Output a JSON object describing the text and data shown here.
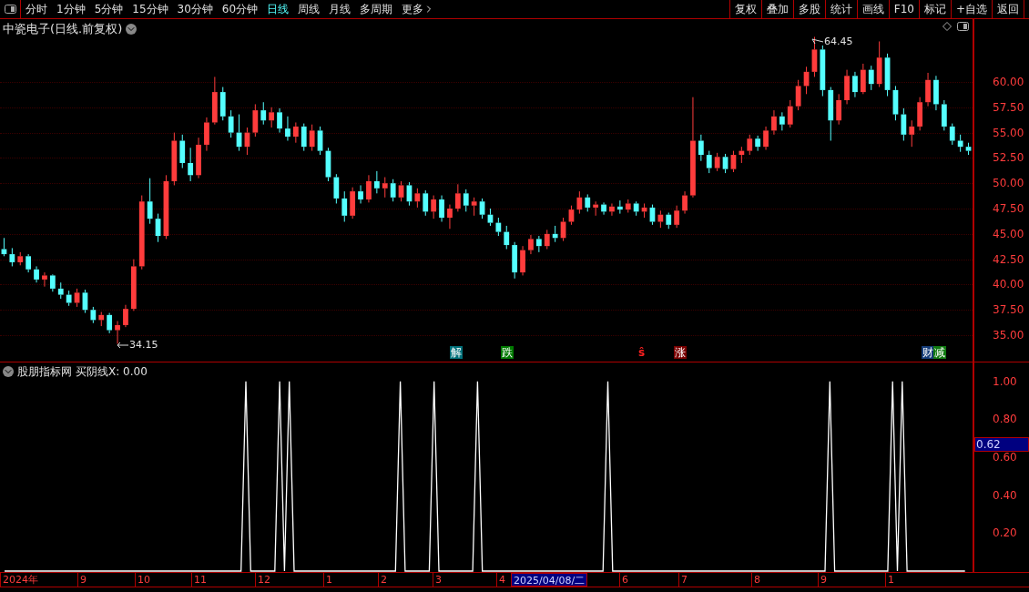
{
  "toolbar": {
    "periods": [
      {
        "label": "分时",
        "selected": false
      },
      {
        "label": "1分钟",
        "selected": false
      },
      {
        "label": "5分钟",
        "selected": false
      },
      {
        "label": "15分钟",
        "selected": false
      },
      {
        "label": "30分钟",
        "selected": false
      },
      {
        "label": "60分钟",
        "selected": false
      },
      {
        "label": "日线",
        "selected": true
      },
      {
        "label": "周线",
        "selected": false
      },
      {
        "label": "月线",
        "selected": false
      },
      {
        "label": "多周期",
        "selected": false
      }
    ],
    "more": "更多",
    "buttons": [
      "复权",
      "叠加",
      "多股",
      "统计",
      "画线",
      "F10",
      "标记",
      "+自选",
      "返回"
    ]
  },
  "price_pane": {
    "title": "中瓷电子(日线.前复权)",
    "high_label": "64.45",
    "low_label": "34.15",
    "signals": [
      {
        "text": "解",
        "kind": "boxed",
        "color": "#00707a"
      },
      {
        "text": "跌",
        "kind": "boxed",
        "color": "#007a00"
      },
      {
        "text": "ŝ",
        "kind": "plain",
        "color": "#ff2020"
      },
      {
        "text": "涨",
        "kind": "boxed",
        "color": "#7a0000"
      },
      {
        "text": "财",
        "kind": "boxed",
        "color": "#153c78"
      },
      {
        "text": "减",
        "kind": "boxed",
        "color": "#107a10"
      }
    ],
    "chart_data": {
      "type": "candlestick",
      "ylim": [
        32.4,
        66.2
      ],
      "grid": true,
      "yticks": [
        {
          "value": 60,
          "label": "60.00"
        },
        {
          "value": 57.5,
          "label": "57.50"
        },
        {
          "value": 55,
          "label": "55.00"
        },
        {
          "value": 52.5,
          "label": "52.50"
        },
        {
          "value": 50,
          "label": "50.00"
        },
        {
          "value": 47.5,
          "label": "47.50"
        },
        {
          "value": 45,
          "label": "45.00"
        },
        {
          "value": 42.5,
          "label": "42.50"
        },
        {
          "value": 40,
          "label": "40.00"
        },
        {
          "value": 37.5,
          "label": "37.50"
        },
        {
          "value": 35,
          "label": "35.00"
        }
      ],
      "categories": [
        null,
        null,
        null,
        null,
        null,
        null,
        null,
        null,
        null,
        null,
        null,
        null,
        null,
        null,
        null,
        null,
        null,
        null,
        null,
        null,
        null,
        null,
        null,
        null,
        null,
        null,
        null,
        null,
        null,
        null,
        null,
        null,
        null,
        null,
        null,
        null,
        null,
        null,
        null,
        null,
        null,
        null,
        null,
        null,
        null,
        null,
        null,
        null,
        null,
        null,
        null,
        null,
        null,
        null,
        null,
        null,
        null,
        null,
        null,
        null,
        null,
        null,
        null,
        null,
        null,
        null,
        null,
        null,
        null,
        null,
        null,
        null,
        null,
        null,
        null,
        null,
        null,
        null,
        null,
        null,
        null,
        null,
        null,
        null,
        null,
        null,
        null,
        null,
        null,
        null,
        null,
        null,
        null,
        null,
        null,
        null,
        null,
        null,
        null,
        null,
        null,
        null,
        null,
        null,
        null,
        null,
        null,
        null,
        null,
        null,
        null,
        null,
        null,
        null,
        null,
        null,
        null,
        null,
        null,
        null
      ],
      "ohlc": [
        [
          43.5,
          44.6,
          42.8,
          43.0
        ],
        [
          43.0,
          43.6,
          41.8,
          42.2
        ],
        [
          42.2,
          43.2,
          41.9,
          42.8
        ],
        [
          42.8,
          43.0,
          41.2,
          41.5
        ],
        [
          41.5,
          41.8,
          40.2,
          40.5
        ],
        [
          40.5,
          41.2,
          39.8,
          40.9
        ],
        [
          40.9,
          41.0,
          39.3,
          39.6
        ],
        [
          39.6,
          40.2,
          38.6,
          39.0
        ],
        [
          39.0,
          39.4,
          37.9,
          38.2
        ],
        [
          38.2,
          39.6,
          37.8,
          39.2
        ],
        [
          39.2,
          39.5,
          37.2,
          37.5
        ],
        [
          37.5,
          37.8,
          36.2,
          36.5
        ],
        [
          36.5,
          37.3,
          35.9,
          37.0
        ],
        [
          37.0,
          37.2,
          35.2,
          35.5
        ],
        [
          35.5,
          36.4,
          34.15,
          36.0
        ],
        [
          36.0,
          38.0,
          35.8,
          37.6
        ],
        [
          37.6,
          42.5,
          37.4,
          41.8
        ],
        [
          41.8,
          48.8,
          41.5,
          48.2
        ],
        [
          48.2,
          50.5,
          46.0,
          46.5
        ],
        [
          46.5,
          47.0,
          44.2,
          44.8
        ],
        [
          44.8,
          50.8,
          44.5,
          50.2
        ],
        [
          50.2,
          55.0,
          49.8,
          54.2
        ],
        [
          54.2,
          54.8,
          51.5,
          52.0
        ],
        [
          52.0,
          53.5,
          50.2,
          50.8
        ],
        [
          50.8,
          54.5,
          50.5,
          53.8
        ],
        [
          53.8,
          56.5,
          53.2,
          56.0
        ],
        [
          56.0,
          60.5,
          55.8,
          59.0
        ],
        [
          59.0,
          59.5,
          56.2,
          56.6
        ],
        [
          56.6,
          57.2,
          54.5,
          55.0
        ],
        [
          55.0,
          56.8,
          53.2,
          53.6
        ],
        [
          53.6,
          55.5,
          52.8,
          55.0
        ],
        [
          55.0,
          57.8,
          54.6,
          57.2
        ],
        [
          57.2,
          58.0,
          55.8,
          56.2
        ],
        [
          56.2,
          57.5,
          55.5,
          57.0
        ],
        [
          57.0,
          57.4,
          55.0,
          55.4
        ],
        [
          55.4,
          56.6,
          54.2,
          54.6
        ],
        [
          54.6,
          56.0,
          54.0,
          55.6
        ],
        [
          55.6,
          55.9,
          53.2,
          53.6
        ],
        [
          53.6,
          55.8,
          53.2,
          55.2
        ],
        [
          55.2,
          55.6,
          52.8,
          53.2
        ],
        [
          53.2,
          53.5,
          50.2,
          50.6
        ],
        [
          50.6,
          50.9,
          48.0,
          48.5
        ],
        [
          48.5,
          49.2,
          46.2,
          46.8
        ],
        [
          46.8,
          49.6,
          46.5,
          49.2
        ],
        [
          49.2,
          49.8,
          48.0,
          48.4
        ],
        [
          48.4,
          50.8,
          48.1,
          50.2
        ],
        [
          50.2,
          51.2,
          49.0,
          49.5
        ],
        [
          49.5,
          50.6,
          48.6,
          50.0
        ],
        [
          50.0,
          50.4,
          48.2,
          48.6
        ],
        [
          48.6,
          50.2,
          48.2,
          49.8
        ],
        [
          49.8,
          50.1,
          47.8,
          48.2
        ],
        [
          48.2,
          49.5,
          47.6,
          49.0
        ],
        [
          49.0,
          49.3,
          46.8,
          47.2
        ],
        [
          47.2,
          48.8,
          46.5,
          48.4
        ],
        [
          48.4,
          48.8,
          46.2,
          46.6
        ],
        [
          46.6,
          47.9,
          45.5,
          47.5
        ],
        [
          47.5,
          49.9,
          47.2,
          49.0
        ],
        [
          49.0,
          49.4,
          47.2,
          47.8
        ],
        [
          47.8,
          48.6,
          46.8,
          48.2
        ],
        [
          48.2,
          48.5,
          46.5,
          46.9
        ],
        [
          46.9,
          47.5,
          45.8,
          46.1
        ],
        [
          46.1,
          46.6,
          44.8,
          45.2
        ],
        [
          45.2,
          45.8,
          43.5,
          43.9
        ],
        [
          43.9,
          44.2,
          40.6,
          41.2
        ],
        [
          41.2,
          43.8,
          40.9,
          43.4
        ],
        [
          43.4,
          44.9,
          43.0,
          44.5
        ],
        [
          44.5,
          44.8,
          43.2,
          43.8
        ],
        [
          43.8,
          45.4,
          43.5,
          45.0
        ],
        [
          45.0,
          45.8,
          44.2,
          44.6
        ],
        [
          44.6,
          46.6,
          44.3,
          46.2
        ],
        [
          46.2,
          47.8,
          45.9,
          47.4
        ],
        [
          47.4,
          49.2,
          47.0,
          48.6
        ],
        [
          48.6,
          48.9,
          47.2,
          47.6
        ],
        [
          47.6,
          48.2,
          46.8,
          47.9
        ],
        [
          47.9,
          48.1,
          46.9,
          47.2
        ],
        [
          47.2,
          48.0,
          46.8,
          47.7
        ],
        [
          47.7,
          48.3,
          47.0,
          47.4
        ],
        [
          47.4,
          48.4,
          47.1,
          48.0
        ],
        [
          48.0,
          48.2,
          46.8,
          47.2
        ],
        [
          47.2,
          48.0,
          46.6,
          47.6
        ],
        [
          47.6,
          47.9,
          45.9,
          46.2
        ],
        [
          46.2,
          47.3,
          45.6,
          46.9
        ],
        [
          46.9,
          47.1,
          45.5,
          45.9
        ],
        [
          45.9,
          47.8,
          45.6,
          47.3
        ],
        [
          47.3,
          49.2,
          47.0,
          48.8
        ],
        [
          48.8,
          58.5,
          48.6,
          54.2
        ],
        [
          54.2,
          54.8,
          52.2,
          52.8
        ],
        [
          52.8,
          53.2,
          51.0,
          51.5
        ],
        [
          51.5,
          53.0,
          51.2,
          52.6
        ],
        [
          52.6,
          52.9,
          51.0,
          51.4
        ],
        [
          51.4,
          53.2,
          51.1,
          52.8
        ],
        [
          52.8,
          53.6,
          52.0,
          53.2
        ],
        [
          53.2,
          54.8,
          52.8,
          54.4
        ],
        [
          54.4,
          54.7,
          53.2,
          53.6
        ],
        [
          53.6,
          55.6,
          53.3,
          55.2
        ],
        [
          55.2,
          57.2,
          54.8,
          56.6
        ],
        [
          56.6,
          57.0,
          55.2,
          55.8
        ],
        [
          55.8,
          58.2,
          55.5,
          57.6
        ],
        [
          57.6,
          60.2,
          57.2,
          59.6
        ],
        [
          59.6,
          61.5,
          58.8,
          61.0
        ],
        [
          61.0,
          64.45,
          60.5,
          63.2
        ],
        [
          63.2,
          63.6,
          58.6,
          59.2
        ],
        [
          59.2,
          59.5,
          54.2,
          56.2
        ],
        [
          56.2,
          58.8,
          55.8,
          58.2
        ],
        [
          58.2,
          61.2,
          57.8,
          60.6
        ],
        [
          60.6,
          61.0,
          58.5,
          59.0
        ],
        [
          59.0,
          61.8,
          58.8,
          61.2
        ],
        [
          61.2,
          61.6,
          59.2,
          59.8
        ],
        [
          59.8,
          64.0,
          59.5,
          62.4
        ],
        [
          62.4,
          62.8,
          58.6,
          59.2
        ],
        [
          59.2,
          59.6,
          56.2,
          56.8
        ],
        [
          56.8,
          57.4,
          54.2,
          54.8
        ],
        [
          54.8,
          56.2,
          53.6,
          55.6
        ],
        [
          55.6,
          58.5,
          55.2,
          58.0
        ],
        [
          58.0,
          60.9,
          57.6,
          60.2
        ],
        [
          60.2,
          60.6,
          57.2,
          57.8
        ],
        [
          57.8,
          58.2,
          55.2,
          55.6
        ],
        [
          55.6,
          55.9,
          53.8,
          54.2
        ],
        [
          54.2,
          54.8,
          53.1,
          53.6
        ],
        [
          53.6,
          54.0,
          52.8,
          53.2
        ]
      ]
    }
  },
  "indicator_pane": {
    "title": "股朋指标网",
    "line": "买阴线X: 0.00",
    "cursor_value": "0.62",
    "chart_data": {
      "type": "line",
      "ylim": [
        0,
        1.1
      ],
      "yticks": [
        {
          "value": 1,
          "label": "1.00"
        },
        {
          "value": 0.8,
          "label": "0.80"
        },
        {
          "value": 0.6,
          "label": "0.60"
        },
        {
          "value": 0.4,
          "label": "0.40"
        },
        {
          "value": 0.2,
          "label": "0.20"
        }
      ],
      "categories": [
        null,
        null,
        null,
        null,
        null,
        null,
        null,
        null,
        null,
        null,
        null,
        null,
        null,
        null,
        null,
        null,
        null,
        null,
        null,
        null,
        null,
        null,
        null,
        null,
        null,
        null,
        null,
        null,
        null,
        null,
        null,
        null,
        null,
        null,
        null,
        null,
        null,
        null,
        null,
        null,
        null,
        null,
        null,
        null,
        null,
        null,
        null,
        null,
        null,
        null,
        null,
        null,
        null,
        null,
        null,
        null,
        null,
        null,
        null,
        null,
        null,
        null,
        null,
        null,
        null,
        null,
        null,
        null,
        null,
        null,
        null,
        null,
        null,
        null,
        null,
        null,
        null,
        null,
        null,
        null,
        null,
        null,
        null,
        null,
        null,
        null,
        null,
        null,
        null,
        null,
        null,
        null,
        null,
        null,
        null,
        null,
        null,
        null,
        null,
        null,
        null,
        null,
        null,
        null,
        null,
        null,
        null,
        null,
        null,
        null,
        null,
        null,
        null,
        null,
        null,
        null,
        null,
        null,
        null,
        null,
        null,
        null,
        null,
        null,
        null,
        null,
        null,
        null,
        null,
        null,
        null,
        null,
        null,
        null,
        null,
        null,
        null,
        null,
        null,
        null,
        null,
        null,
        null,
        null,
        null,
        null,
        null,
        null,
        null,
        null,
        null,
        null,
        null,
        null,
        null,
        null,
        null,
        null,
        null,
        null,
        null,
        null,
        null,
        null,
        null,
        null,
        null,
        null,
        null,
        null,
        null,
        null,
        null,
        null,
        null,
        null,
        null,
        null,
        null,
        null,
        null,
        null,
        null,
        null,
        null,
        null,
        null,
        null,
        null,
        null,
        null,
        null,
        null,
        null,
        null,
        null,
        null,
        null,
        null,
        null
      ],
      "series": [
        {
          "color": "#ffffff",
          "values": [
            0,
            0,
            0,
            0,
            0,
            0,
            0,
            0,
            0,
            0,
            0,
            0,
            0,
            0,
            0,
            0,
            0,
            0,
            0,
            0,
            0,
            0,
            0,
            0,
            0,
            0,
            0,
            0,
            0,
            0,
            0,
            0,
            0,
            0,
            0,
            0,
            0,
            0,
            0,
            0,
            0,
            0,
            0,
            0,
            0,
            0,
            0,
            0,
            0,
            0,
            1,
            0,
            0,
            0,
            0,
            0,
            0,
            1,
            0,
            1,
            0,
            0,
            0,
            0,
            0,
            0,
            0,
            0,
            0,
            0,
            0,
            0,
            0,
            0,
            0,
            0,
            0,
            0,
            0,
            0,
            0,
            0,
            1,
            0,
            0,
            0,
            0,
            0,
            0,
            1,
            0,
            0,
            0,
            0,
            0,
            0,
            0,
            0,
            1,
            0,
            0,
            0,
            0,
            0,
            0,
            0,
            0,
            0,
            0,
            0,
            0,
            0,
            0,
            0,
            0,
            0,
            0,
            0,
            0,
            0,
            0,
            0,
            0,
            0,
            0,
            1,
            0,
            0,
            0,
            0,
            0,
            0,
            0,
            0,
            0,
            0,
            0,
            0,
            0,
            0,
            0,
            0,
            0,
            0,
            0,
            0,
            0,
            0,
            0,
            0,
            0,
            0,
            0,
            0,
            0,
            0,
            0,
            0,
            0,
            0,
            0,
            0,
            0,
            0,
            0,
            0,
            0,
            0,
            0,
            0,
            0,
            1,
            0,
            0,
            0,
            0,
            0,
            0,
            0,
            0,
            0,
            0,
            0,
            0,
            1,
            0,
            1,
            0,
            0,
            0,
            0,
            0,
            0,
            0,
            0,
            0,
            0,
            0,
            0,
            0
          ]
        }
      ]
    }
  },
  "time_axis": {
    "labels": [
      {
        "text": "2024年",
        "selected": false
      },
      {
        "text": "9",
        "selected": false
      },
      {
        "text": "10",
        "selected": false
      },
      {
        "text": "11",
        "selected": false
      },
      {
        "text": "12",
        "selected": false
      },
      {
        "text": "1",
        "selected": false
      },
      {
        "text": "2",
        "selected": false
      },
      {
        "text": "3",
        "selected": false
      },
      {
        "text": "4",
        "selected": false
      },
      {
        "text": "2025/04/08/二",
        "selected": true
      },
      {
        "text": "6",
        "selected": false
      },
      {
        "text": "7",
        "selected": false
      },
      {
        "text": "8",
        "selected": false
      },
      {
        "text": "9",
        "selected": false
      },
      {
        "text": "1",
        "selected": false
      }
    ]
  }
}
